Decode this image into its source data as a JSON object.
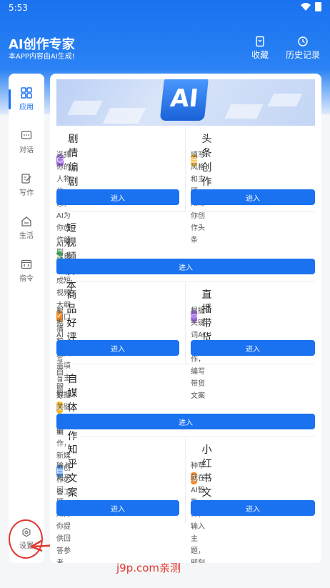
{
  "status_bar": {
    "time": "5:53"
  },
  "header": {
    "title": "AI创作专家",
    "subtitle": "本APP内容由AI生成!",
    "favorites_label": "收藏",
    "history_label": "历史记录"
  },
  "sidebar": {
    "items": [
      {
        "label": "应用",
        "icon": "grid-icon"
      },
      {
        "label": "对话",
        "icon": "chat-icon"
      },
      {
        "label": "写作",
        "icon": "edit-icon"
      },
      {
        "label": "生活",
        "icon": "home-icon"
      },
      {
        "label": "指令",
        "icon": "code-window-icon"
      }
    ],
    "settings_label": "设置"
  },
  "banner": {
    "text": "AI"
  },
  "cards": [
    {
      "title": "剧情编剧",
      "desc": "选择你的人物信息，AI为你创作编剧",
      "button": "进入",
      "icon_color": "#a36ce8"
    },
    {
      "title": "头条创作",
      "desc": "填写风格和主题，AI帮你创作头条",
      "button": "进入",
      "icon_color": "#f4b62a"
    },
    {
      "title": "短视频脚本",
      "desc": "AI为您自动生成短视频大纲和口播稿，你只需填写主题",
      "button": "进入",
      "icon_color": "#3bc25a"
    },
    {
      "title": "商品好评",
      "desc": "根据AI编写商品好评文案",
      "button": "进入",
      "icon_color": "#f08a2a"
    },
    {
      "title": "直播带货",
      "desc": "根据关键词AI创作，编写带货文案",
      "button": "进入",
      "icon_color": "#a36ce8"
    },
    {
      "title": "自媒体写作",
      "desc": "根据关键词AI创作，新媒体创作必备工具",
      "button": "进入",
      "icon_color": "#f4b62a"
    },
    {
      "title": "知乎文案",
      "desc": "输入知乎问题，AI为你提供回答参考",
      "button": "进入",
      "icon_color": "#3d8ff0"
    },
    {
      "title": "小红书文案",
      "desc": "种草就在AI智能体，输入主题，即刻",
      "desc2": "种草",
      "button": "进入",
      "icon_color": "#f08a2a"
    }
  ],
  "watermark": "j9p.com亲测",
  "colors": {
    "primary": "#1a72f0",
    "annotation": "#e2372f"
  }
}
